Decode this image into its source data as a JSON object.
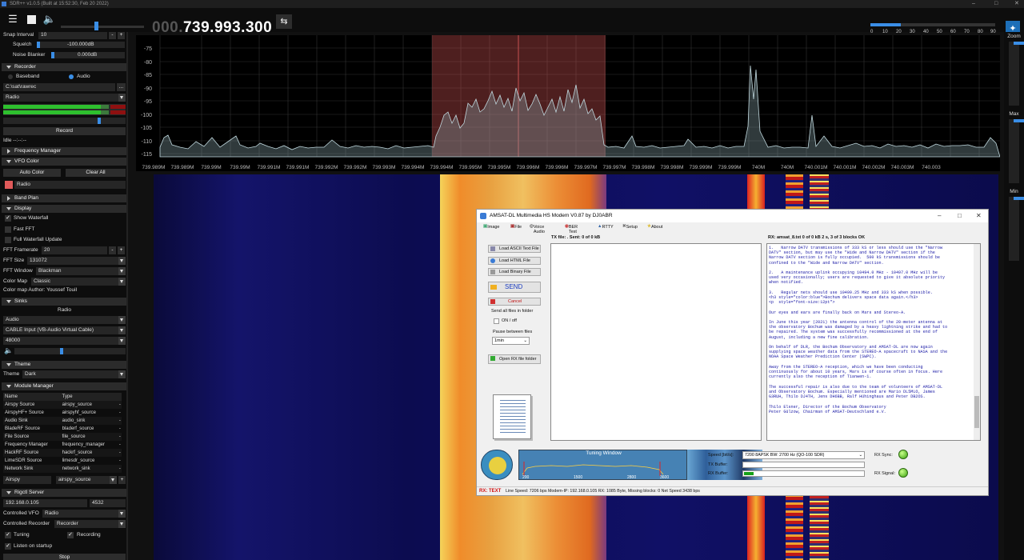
{
  "window": {
    "title": "SDR++ v1.0.5 (Built at 15:52:30, Feb 20 2022)"
  },
  "toolbar": {
    "frequency_dim": "000.",
    "frequency_main": "739.993.300",
    "snr_ticks": [
      "0",
      "10",
      "20",
      "30",
      "40",
      "50",
      "60",
      "70",
      "80",
      "90"
    ]
  },
  "sidebar": {
    "snap_interval_label": "Snap Interval",
    "snap_interval_value": "10",
    "squelch_label": "Squelch",
    "squelch_value": "-100.000dB",
    "noise_blanker_label": "Noise Blanker",
    "noise_blanker_value": "0.000dB",
    "recorder": {
      "header": "Recorder",
      "baseband": "Baseband",
      "audio": "Audio",
      "path": "C:\\sat\\rawrec",
      "stream": "Radio",
      "record_button": "Record",
      "status": "Idle --:--:--"
    },
    "frequency_manager_header": "Frequency Manager",
    "vfo_color": {
      "header": "VFO Color",
      "auto_color": "Auto Color",
      "clear_all": "Clear All",
      "vfo_name": "Radio",
      "vfo_color": "#e05a5a"
    },
    "band_plan_header": "Band Plan",
    "display": {
      "header": "Display",
      "show_waterfall": "Show Waterfall",
      "fast_fft": "Fast FFT",
      "full_waterfall_update": "Full Waterfall Update",
      "fft_framerate_label": "FFT Framerate",
      "fft_framerate_value": "20",
      "fft_size_label": "FFT Size",
      "fft_size_value": "131072",
      "fft_window_label": "FFT Window",
      "fft_window_value": "Blackman",
      "color_map_label": "Color Map",
      "color_map_value": "Classic",
      "color_map_author": "Color map Author: Youssef Touil"
    },
    "sinks": {
      "header": "Sinks",
      "sink_name": "Radio",
      "sink_type": "Audio",
      "device": "CABLE Input (VB-Audio Virtual Cable)",
      "sample_rate": "48000"
    },
    "theme": {
      "header": "Theme",
      "label": "Theme",
      "value": "Dark"
    },
    "module_manager": {
      "header": "Module Manager",
      "columns": [
        "Name",
        "Type"
      ],
      "rows": [
        [
          "Airspy Source",
          "airspy_source"
        ],
        [
          "AirspyHF+ Source",
          "airspyhf_source"
        ],
        [
          "Audio Sink",
          "audio_sink"
        ],
        [
          "BladeRF Source",
          "bladerf_source"
        ],
        [
          "File Source",
          "file_source"
        ],
        [
          "Frequency Manager",
          "frequency_manager"
        ],
        [
          "HackRF Source",
          "hackrf_source"
        ],
        [
          "LimeSDR Source",
          "limesdr_source"
        ],
        [
          "Network Sink",
          "network_sink"
        ]
      ],
      "new_name": "Airspy",
      "new_type": "airspy_source"
    },
    "rigctl": {
      "header": "Rigctl Server",
      "host": "192.168.0.105",
      "port": "4532",
      "controlled_vfo_label": "Controlled VFO",
      "controlled_vfo_value": "Radio",
      "controlled_recorder_label": "Controlled Recorder",
      "controlled_recorder_value": "Recorder",
      "tuning": "Tuning",
      "recording": "Recording",
      "listen_on_startup": "Listen on startup",
      "stop_button": "Stop"
    }
  },
  "fft": {
    "y_ticks": [
      "-75",
      "-80",
      "-85",
      "-90",
      "-95",
      "-100",
      "-105",
      "-110",
      "-115"
    ],
    "x_ticks": [
      "739.989M",
      "739.989M",
      "739.99M",
      "739.99M",
      "739.991M",
      "739.991M",
      "739.992M",
      "739.992M",
      "739.993M",
      "739.994M",
      "739.994M",
      "739.995M",
      "739.995M",
      "739.996M",
      "739.996M",
      "739.997M",
      "739.997M",
      "739.998M",
      "739.998M",
      "739.999M",
      "739.999M",
      "740M",
      "740M",
      "740.001M",
      "740.001M",
      "740.002M",
      "740.003M",
      "740.003"
    ]
  },
  "right_bar": {
    "zoom": "Zoom",
    "max": "Max",
    "min": "Min"
  },
  "modem": {
    "title": "AMSAT-DL Multimedia HS Modem V0.87 by DJ0ABR",
    "tabs": [
      "Image",
      "File",
      "Voice Audio",
      "BER Test",
      "RTTY",
      "Setup",
      "About"
    ],
    "tx_file": "TX file:  . Sent: 0 of 0 kB",
    "rx_file": "RX: amsat_8.txt 0 of 0 kB 2 s, 3 of 3 blocks OK",
    "buttons": {
      "load_ascii": "Load ASCII Text File",
      "load_html": "Load HTML File",
      "load_binary": "Load Binary File",
      "send": "SEND",
      "cancel": "Cancel",
      "open_rx": "Open RX file folder"
    },
    "send_all_label": "Send all files in folder",
    "on_off": "ON / off",
    "pause_label": "Pause between files",
    "pause_value": "1min",
    "rx_text": "1.   Narrow DATV transmissions of 333 kS or less should use the \"Narrow\nDATV\" section, but may use the \"Wide and Narrow DATV\" section if the\nNarrow DATV section is fully occupied.  500 kS transmissions should be\nconfined to the \"Wide and Narrow DATV\" section.\n\n2.   A maintenance uplink occupying 10494.0 MHz - 10497.0 MHz will be\nused very occasionally; users are requested to give it absolute priority\nwhen notified.\n\n3.   Regular nets should use 10499.25 MHz and 333 kS when possible.\n<h3 style=\"color:blue\">Bochum delivers space data again.</h3>\n<p  style=\"font-size:12pt\">\n\nOur eyes and ears are finally back on Mars and Stereo-A.\n\nIn June this year (2021) the antenna control of the 20-meter antenna at\nthe observatory Bochum was damaged by a heavy lightning strike and had to\nbe repaired. The system was successfully recommissioned at the end of\nAugust, including a new fine calibration.\n\nOn behalf of DLR, the Bochum Observatory and AMSAT-DL are now again\nsupplying space weather data from the STEREO-A spacecraft to NASA and the\nNOAA Space Weather Prediction Center (SWPC).\n\nAway from the STEREO-A reception, which we have been conducting\ncontinuously for about 10 years, Mars is of course often in focus. Here\ncurrently also the reception of Tianwen-1.\n\nThe successful repair is also due to the team of volunteers of AMSAT-DL\nand Observatory Bochum. Especially mentioned are Mario DL5MLO, James\nG3RUH, Thilo DJ4TH, Jens DH6BB, Ralf Hühinghaus and Peter DB2OS.\n\nThilo Elsner, Director of the Bochum Observatory\nPeter Gülzow, Chairman of AMSAT-Deutschland e.V.",
    "tuning_title": "Tuning Window",
    "tuning_ticks": [
      "200",
      "1500",
      "2800",
      "3600"
    ],
    "speed_label": "Speed [bit/s]:",
    "speed_value": "7200 8APSK BW: 2700 Hz (QO-100 SDR)",
    "tx_buffer_label": "TX Buffer:",
    "rx_buffer_label": "RX Buffer:",
    "rx_sync_label": "RX Sync:",
    "rx_signal_label": "RX Signal:",
    "status_prefix": "RX: TEXT",
    "status_text": "Line Speed: 7206 bps   Modem-IP: 192.168.0.105   RX: 1085 Byte, Missing blocks: 0 Net Speed 3438 bps"
  }
}
